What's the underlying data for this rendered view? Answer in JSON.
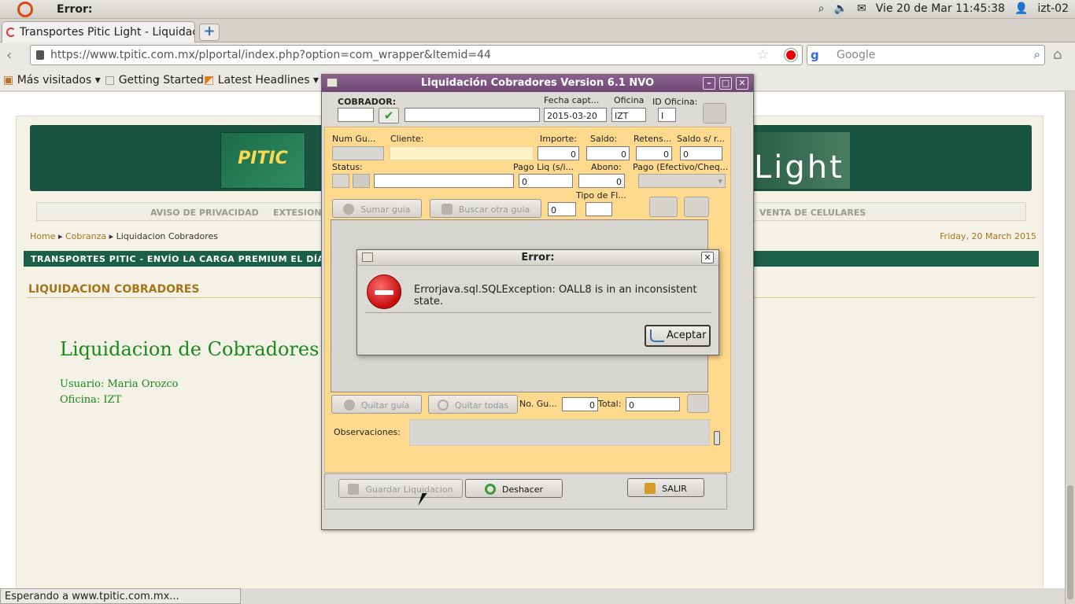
{
  "topbar": {
    "title": "Error:",
    "datetime": "Vie 20 de Mar 11:45:38",
    "user": "izt-02"
  },
  "browser": {
    "tab_title": "Transportes Pitic Light - Liquidac...",
    "new_tab": "+",
    "url": "https://www.tpitic.com.mx/plportal/index.php?option=com_wrapper&Itemid=44",
    "search_placeholder": "Google",
    "bookmarks": [
      "Más visitados",
      "Getting Started",
      "Latest Headlines"
    ],
    "status": "Esperando a www.tpitic.com.mx..."
  },
  "page": {
    "logo_text": "PITIC",
    "brand_light": "Light",
    "menu": [
      "AVISO DE PRIVACIDAD",
      "EXTESIONES",
      "VENTA DE CELULARES"
    ],
    "breadcrumb": [
      "Home",
      "Cobranza",
      "Liquidacion Cobradores"
    ],
    "date": "Friday, 20 March 2015",
    "marquee": "TRANSPORTES PITIC - ENVÍO LA CARGA PREMIUM EL DÍA C",
    "section_title": "LIQUIDACION COBRADORES",
    "heading": "Liquidacion de Cobradores",
    "usuario": "Usuario: Maria Orozco",
    "oficina": "Oficina: IZT"
  },
  "app": {
    "title": "Liquidación Cobradores Version 6.1 NVO",
    "labels": {
      "cobrador": "COBRADOR:",
      "fecha": "Fecha capt...",
      "oficina": "Oficina",
      "id_oficina": "ID Oficina:",
      "num_guia": "Num Gu...",
      "cliente": "Cliente:",
      "importe": "Importe:",
      "saldo": "Saldo:",
      "retens": "Retens...",
      "saldo_sr": "Saldo s/ r...",
      "status": "Status:",
      "pago_liq": "Pago Liq (s/i...",
      "abono": "Abono:",
      "pago_efectivo": "Pago (Efectivo/Cheq...",
      "tipo_fl": "Tipo de Fl...",
      "no_guias": "No. Gu...",
      "total": "Total:",
      "observaciones": "Observaciones:"
    },
    "values": {
      "fecha": "2015-03-20",
      "oficina": "IZT",
      "id_oficina": "I",
      "importe": "0",
      "saldo": "0",
      "retens": "0",
      "saldo_sr": "0",
      "pago_liq": "0",
      "abono": "0",
      "tipo_fl": "0",
      "no_guias": "0",
      "total": "0"
    },
    "buttons": {
      "sumar": "Sumar guía",
      "buscar": "Buscar otra guía",
      "quitar": "Quitar guía",
      "quitar_todas": "Quitar todas",
      "guardar": "Guardar Liquidacion",
      "deshacer": "Deshacer",
      "salir": "SALIR"
    }
  },
  "dialog": {
    "title": "Error:",
    "message": "Errorjava.sql.SQLException: OALL8 is in an inconsistent state.",
    "ok": "Aceptar"
  }
}
